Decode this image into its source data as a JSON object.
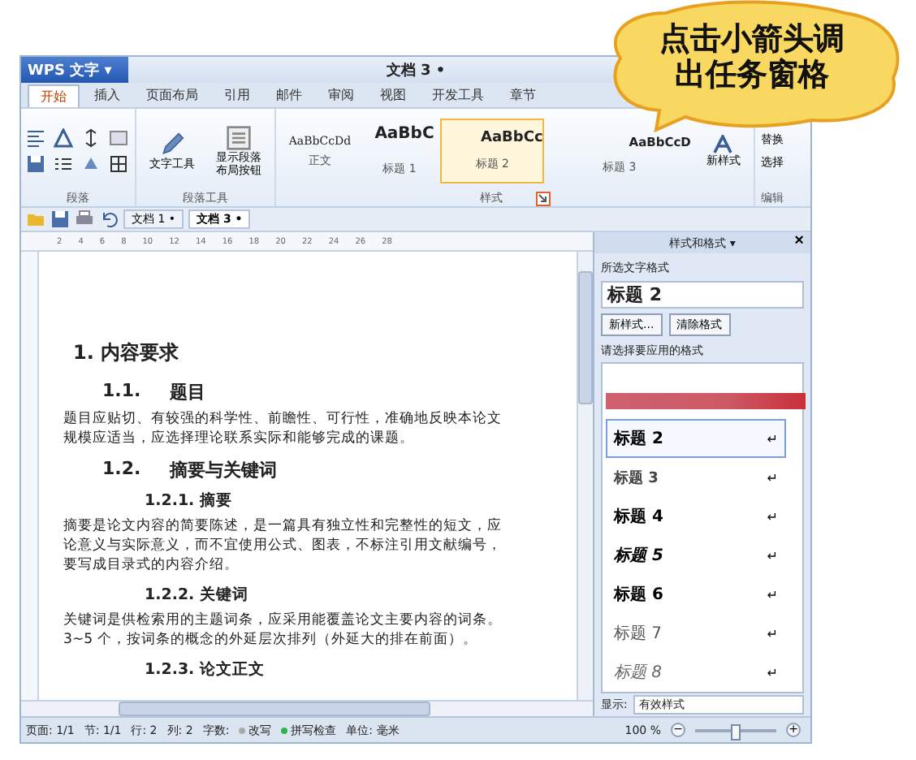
{
  "callout": {
    "lines": [
      "点击小箭头调",
      "出任务窗格"
    ]
  },
  "app_button": {
    "label": "WPS 文字",
    "caret": "▾"
  },
  "window": {
    "title": "文档 3 •"
  },
  "menu_tabs": [
    {
      "label": "开始",
      "selected": true
    },
    {
      "label": "插入",
      "selected": false
    },
    {
      "label": "页面布局",
      "selected": false
    },
    {
      "label": "引用",
      "selected": false
    },
    {
      "label": "邮件",
      "selected": false
    },
    {
      "label": "审阅",
      "selected": false
    },
    {
      "label": "视图",
      "selected": false
    },
    {
      "label": "开发工具",
      "selected": false
    },
    {
      "label": "章节",
      "selected": false
    }
  ],
  "ribbon": {
    "paragraph_label": "段落",
    "tools": [
      "文字工具",
      "显示段落布局按钮"
    ],
    "tools_label": "段落工具",
    "gallery": [
      {
        "sample": "AaBbCcDd",
        "name": "正文",
        "kind": "normal",
        "selected": false
      },
      {
        "sample": "AaBbC",
        "name": "标题 1",
        "kind": "h1",
        "selected": false
      },
      {
        "sample": "AaBbCc",
        "name": "标题 2",
        "kind": "h2",
        "selected": true
      },
      {
        "sample": "AaBbCcD",
        "name": "标题 3",
        "kind": "h3",
        "selected": false
      }
    ],
    "new_style": "新样式",
    "styles_label": "样式",
    "edit_items": [
      "替换",
      "选择"
    ],
    "edit_label": "编辑"
  },
  "doc_tabs": [
    {
      "label": "文档 1 •",
      "selected": false
    },
    {
      "label": "文档 3 •",
      "selected": true
    }
  ],
  "ruler": [
    "2",
    "4",
    "6",
    "8",
    "10",
    "12",
    "14",
    "16",
    "18",
    "20",
    "22",
    "24",
    "26",
    "28"
  ],
  "document": [
    {
      "kind": "h1",
      "text": "1. 内容要求"
    },
    {
      "kind": "h2",
      "number": "1.1.",
      "text": "题目"
    },
    {
      "kind": "p",
      "lines": [
        "题目应贴切、有较强的科学性、前瞻性、可行性，准确地反映本论文",
        "规模应适当，应选择理论联系实际和能够完成的课题。"
      ]
    },
    {
      "kind": "h2",
      "number": "1.2.",
      "text": "摘要与关键词"
    },
    {
      "kind": "h3",
      "text": "1.2.1. 摘要"
    },
    {
      "kind": "p",
      "lines": [
        "摘要是论文内容的简要陈述，是一篇具有独立性和完整性的短文，应",
        "论意义与实际意义，而不宜使用公式、图表，不标注引用文献编号，",
        "要写成目录式的内容介绍。"
      ]
    },
    {
      "kind": "h3",
      "text": "1.2.2. 关键词"
    },
    {
      "kind": "p",
      "lines": [
        "关键词是供检索用的主题词条，应采用能覆盖论文主要内容的词条。",
        "3~5 个，按词条的概念的外延层次排列（外延大的排在前面）。"
      ]
    },
    {
      "kind": "h3",
      "text": "1.2.3. 论文正文"
    }
  ],
  "style_pane": {
    "title": "样式和格式 ▾",
    "close": "×",
    "current_label": "所选文字格式",
    "current": "标题 2",
    "buttons": [
      "新样式...",
      "清除格式"
    ],
    "apply_label": "请选择要应用的格式",
    "styles": [
      {
        "name": "标题 2",
        "kind": "bold",
        "selected": true
      },
      {
        "name": "标题 3",
        "kind": "semibold",
        "selected": false
      },
      {
        "name": "标题 4",
        "kind": "bold",
        "selected": false
      },
      {
        "name": "标题 5",
        "kind": "bolditalic",
        "selected": false
      },
      {
        "name": "标题 6",
        "kind": "bold",
        "selected": false
      },
      {
        "name": "标题 7",
        "kind": "plain",
        "selected": false
      },
      {
        "name": "标题 8",
        "kind": "italic",
        "selected": false
      }
    ],
    "return_mark": "↵",
    "show_label": "显示:",
    "show_value": "有效样式"
  },
  "status_bar": [
    {
      "label": "页面: 1/1",
      "kind": "text"
    },
    {
      "label": "节: 1/1",
      "kind": "text"
    },
    {
      "label": "行: 2",
      "kind": "text"
    },
    {
      "label": "列: 2",
      "kind": "text"
    },
    {
      "label": "字数:",
      "kind": "text"
    },
    {
      "label": "改写",
      "kind": "toggle",
      "on": false
    },
    {
      "label": "拼写检查",
      "kind": "toggle",
      "on": true
    },
    {
      "label": "单位: 毫米",
      "kind": "text"
    }
  ],
  "zoom": {
    "value": "100 %",
    "minus": "−",
    "plus": "+",
    "level": 0.5
  }
}
